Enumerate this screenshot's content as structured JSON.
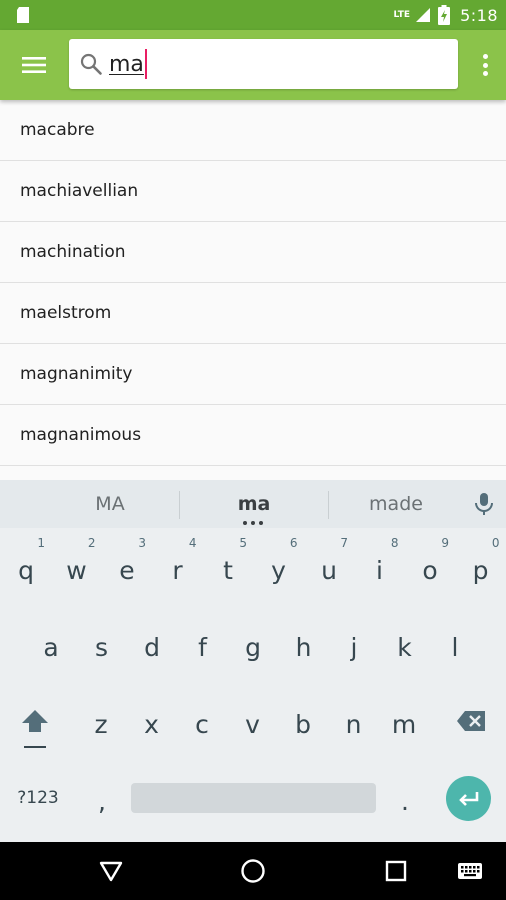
{
  "status_bar": {
    "network_label": "LTE",
    "time": "5:18",
    "icons": [
      "sd-card-icon",
      "signal-icon",
      "battery-charging-icon"
    ]
  },
  "toolbar": {
    "menu_icon": "hamburger-menu-icon",
    "search_icon": "search-icon",
    "search_value": "ma",
    "more_icon": "overflow-menu-icon"
  },
  "results": [
    {
      "word": "macabre"
    },
    {
      "word": "machiavellian"
    },
    {
      "word": "machination"
    },
    {
      "word": "maelstrom"
    },
    {
      "word": "magnanimity"
    },
    {
      "word": "magnanimous"
    }
  ],
  "keyboard": {
    "suggestions": [
      "MA",
      "ma",
      "made"
    ],
    "row1": [
      {
        "key": "q",
        "hint": "1"
      },
      {
        "key": "w",
        "hint": "2"
      },
      {
        "key": "e",
        "hint": "3"
      },
      {
        "key": "r",
        "hint": "4"
      },
      {
        "key": "t",
        "hint": "5"
      },
      {
        "key": "y",
        "hint": "6"
      },
      {
        "key": "u",
        "hint": "7"
      },
      {
        "key": "i",
        "hint": "8"
      },
      {
        "key": "o",
        "hint": "9"
      },
      {
        "key": "p",
        "hint": "0"
      }
    ],
    "row2": [
      "a",
      "s",
      "d",
      "f",
      "g",
      "h",
      "j",
      "k",
      "l"
    ],
    "row3": [
      "z",
      "x",
      "c",
      "v",
      "b",
      "n",
      "m"
    ],
    "symbols_label": "?123",
    "comma_label": ",",
    "period_label": "."
  },
  "colors": {
    "status_bar": "#64a832",
    "toolbar": "#8bc34a",
    "caret": "#e91e63",
    "enter_key": "#4db6ac"
  }
}
